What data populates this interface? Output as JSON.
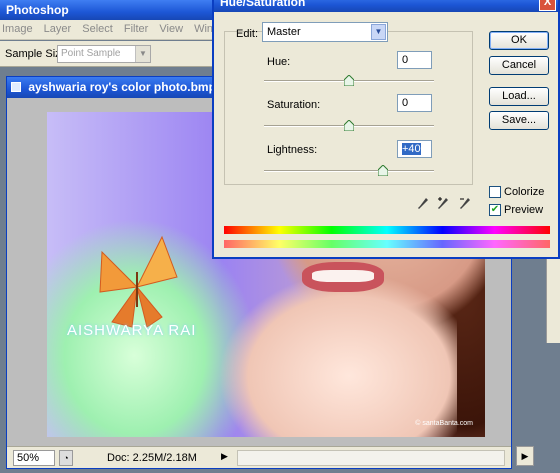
{
  "app": {
    "title": "Photoshop"
  },
  "menubar": {
    "items": [
      "Image",
      "Layer",
      "Select",
      "Filter",
      "View",
      "Window"
    ]
  },
  "options": {
    "sample_size_label": "Sample Size:",
    "sample_size_value": "Point Sample"
  },
  "document": {
    "title": "ayshwaria roy's color photo.bmp @",
    "watermark": "AISHWARYA RAI",
    "copyright": "© santaBanta.com",
    "zoom": "50%",
    "info": "Doc: 2.25M/2.18M"
  },
  "dialog": {
    "title": "Hue/Saturation",
    "close_glyph": "X",
    "edit_label": "Edit:",
    "edit_value": "Master",
    "hue_label": "Hue:",
    "hue_value": "0",
    "saturation_label": "Saturation:",
    "saturation_value": "0",
    "lightness_label": "Lightness:",
    "lightness_value": "+40",
    "ok_label": "OK",
    "cancel_label": "Cancel",
    "load_label": "Load...",
    "save_label": "Save...",
    "colorize_label": "Colorize",
    "preview_label": "Preview",
    "colorize_checked": false,
    "preview_checked": true,
    "hue_level": 0,
    "saturation_level": 0,
    "lightness_level": 40
  },
  "icons": {
    "close": "close-icon",
    "dropdown": "chevron-down-icon",
    "eyedropper": "eyedropper-icon",
    "eyedropper_plus": "eyedropper-plus-icon",
    "eyedropper_minus": "eyedropper-minus-icon",
    "slider_thumb": "slider-thumb-icon"
  },
  "colors": {
    "titlebar": "#1c56d5",
    "dialog_bg": "#ece9d8",
    "accent": "#316ac5"
  }
}
